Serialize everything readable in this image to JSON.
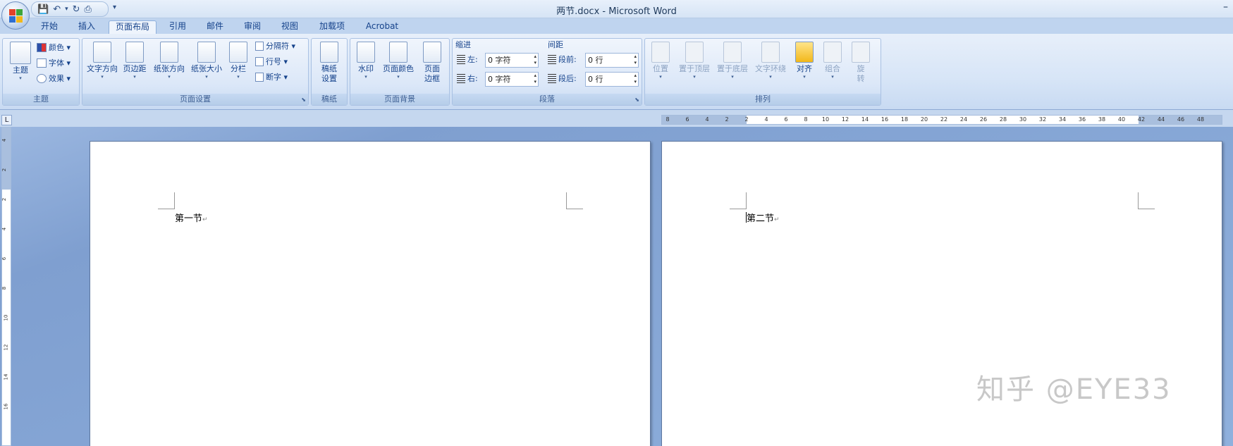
{
  "window": {
    "title": "两节.docx - Microsoft Word",
    "minimize": "–"
  },
  "qat": {
    "save": "💾",
    "undo": "↶",
    "undo_dd": "▾",
    "redo": "↻",
    "print": "⎙",
    "more": "▾"
  },
  "tabs": [
    "开始",
    "插入",
    "页面布局",
    "引用",
    "邮件",
    "审阅",
    "视图",
    "加载项",
    "Acrobat"
  ],
  "active_tab": "页面布局",
  "ribbon": {
    "theme": {
      "label": "主题",
      "button": "主题",
      "colors": "颜色",
      "fonts": "字体",
      "effects": "效果"
    },
    "page_setup": {
      "label": "页面设置",
      "text_direction": "文字方向",
      "margins": "页边距",
      "orientation": "纸张方向",
      "size": "纸张大小",
      "columns": "分栏",
      "breaks": "分隔符",
      "line_numbers": "行号",
      "hyphenation": "断字"
    },
    "manuscript": {
      "label": "稿纸",
      "button_line1": "稿纸",
      "button_line2": "设置"
    },
    "page_background": {
      "label": "页面背景",
      "watermark": "水印",
      "page_color": "页面颜色",
      "page_borders_line1": "页面",
      "page_borders_line2": "边框"
    },
    "paragraph": {
      "label": "段落",
      "indent_title": "缩进",
      "spacing_title": "间距",
      "left_label": "左:",
      "left_value": "0 字符",
      "right_label": "右:",
      "right_value": "0 字符",
      "before_label": "段前:",
      "before_value": "0 行",
      "after_label": "段后:",
      "after_value": "0 行"
    },
    "arrange": {
      "label": "排列",
      "position": "位置",
      "bring_front": "置于顶层",
      "send_back": "置于底层",
      "text_wrap": "文字环绕",
      "align": "对齐",
      "group": "组合",
      "rotate_line1": "旋",
      "rotate_line2": "转"
    }
  },
  "ruler": {
    "horizontal_ticks": [
      "8",
      "6",
      "4",
      "2",
      "2",
      "4",
      "6",
      "8",
      "10",
      "12",
      "14",
      "16",
      "18",
      "20",
      "22",
      "24",
      "26",
      "28",
      "30",
      "32",
      "34",
      "36",
      "38",
      "40",
      "42",
      "44",
      "46",
      "48"
    ],
    "vertical_ticks": [
      "4",
      "2",
      "2",
      "4",
      "6",
      "8",
      "10",
      "12",
      "14",
      "16"
    ]
  },
  "document": {
    "page1_text": "第一节",
    "page2_text": "第二节",
    "paragraph_mark": "↵"
  },
  "watermark_text": "知乎 @EYE33"
}
